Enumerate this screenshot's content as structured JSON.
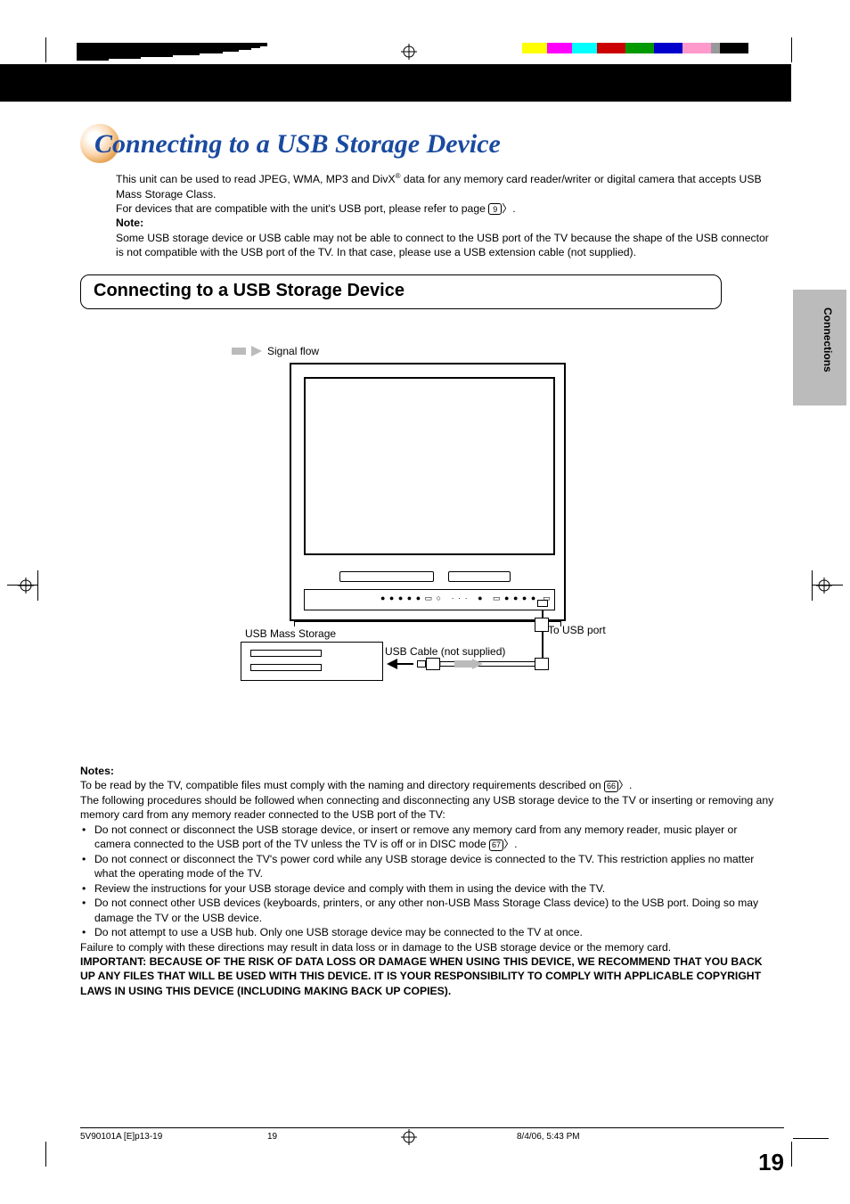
{
  "title": "Connecting to a USB Storage Device",
  "intro": {
    "line1a": "This unit can be used to read JPEG, WMA, MP3 and DivX",
    "line1b": " data for any memory card reader/writer or digital camera that accepts USB Mass Storage Class.",
    "line2a": "For devices that are compatible with the unit's USB port, please refer to page ",
    "pageref1": "9",
    "note_label": "Note:",
    "note_text": "Some USB storage device or USB cable may not be able to connect to the USB port of the TV because the shape of the USB connector is not compatible with the USB port of the TV. In that case, please use a USB extension cable (not supplied)."
  },
  "section_heading": "Connecting to a USB Storage Device",
  "side_tab": "Connections",
  "diagram": {
    "signal_flow": "Signal flow",
    "usb_mass_storage": "USB Mass Storage",
    "usb_cable": "USB Cable (not supplied)",
    "to_usb_port": "To USB port"
  },
  "notes": {
    "label": "Notes:",
    "p1a": "To be read by the TV, compatible files must comply with the naming and directory requirements described on ",
    "pageref66": "66",
    "p2": "The following procedures should be followed when connecting and disconnecting any USB storage device to the TV or inserting or removing any memory card from any memory reader connected to the USB port of the TV:",
    "b1a": "Do not connect or disconnect the USB storage device, or insert or remove any memory card from any memory reader, music player or camera connected to the USB port of the TV unless the TV is off or in DISC mode ",
    "pageref67": "67",
    "b2": "Do not connect or disconnect the TV's power cord while any USB storage device is connected to the TV. This restriction applies no matter what the operating mode of the TV.",
    "b3": "Review the instructions for your USB storage device and comply with them in using the device with the TV.",
    "b4": "Do not connect other USB devices (keyboards, printers, or any other non-USB Mass Storage Class device) to the USB port. Doing so may damage the TV or the USB device.",
    "b5": "Do not attempt to use a USB hub. Only one USB storage device may be connected to the TV at once.",
    "p3": "Failure to comply with these directions may result in data loss or in damage to the USB storage device or the memory card.",
    "important": "IMPORTANT: BECAUSE OF THE RISK OF DATA LOSS OR DAMAGE WHEN USING THIS DEVICE, WE RECOMMEND THAT YOU BACK UP ANY FILES THAT WILL BE USED WITH THIS DEVICE.  IT IS YOUR RESPONSIBILITY TO COMPLY WITH APPLICABLE COPYRIGHT LAWS IN USING THIS DEVICE (INCLUDING MAKING BACK UP COPIES)."
  },
  "page_number": "19",
  "footer": {
    "doc": "5V90101A [E]p13-19",
    "page": "19",
    "timestamp": "8/4/06, 5:43 PM"
  }
}
